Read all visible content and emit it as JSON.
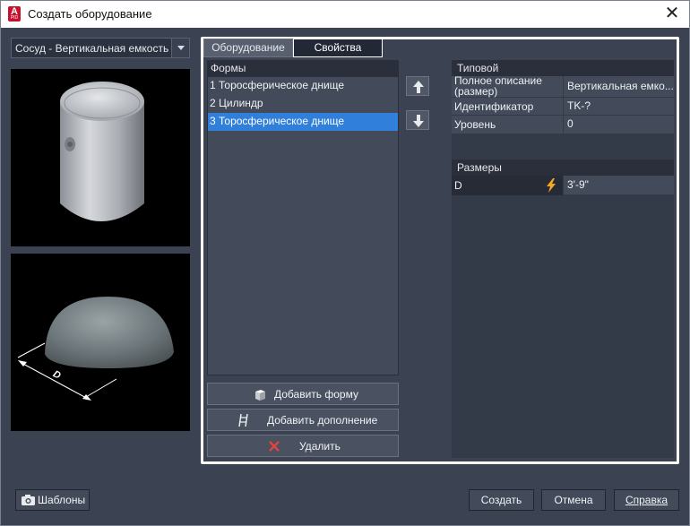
{
  "window": {
    "title": "Создать оборудование",
    "app_icon_letter": "A",
    "app_icon_sub": "PID"
  },
  "type_selector": {
    "value": "Сосуд - Вертикальная емкость"
  },
  "tabs": [
    {
      "label": "Оборудование",
      "active": false
    },
    {
      "label": "Свойства",
      "active": true
    }
  ],
  "shapes": {
    "header": "Формы",
    "items": [
      {
        "label": "1 Торосферическое днище",
        "selected": false
      },
      {
        "label": "2 Цилиндр",
        "selected": false
      },
      {
        "label": "3 Торосферическое днище",
        "selected": true
      }
    ]
  },
  "actions": {
    "add_shape": "Добавить форму",
    "add_addon": "Добавить дополнение",
    "delete": "Удалить"
  },
  "properties": {
    "typical_header": "Типовой",
    "rows": [
      {
        "name": "Полное описание (размер)",
        "value": "Вертикальная емко..."
      },
      {
        "name": "Идентификатор",
        "value": "TK-?"
      },
      {
        "name": "Уровень",
        "value": "0"
      }
    ],
    "sizes_header": "Размеры",
    "size_rows": [
      {
        "name": "D",
        "value": "3'-9\""
      }
    ]
  },
  "preview": {
    "dimension_label": "D"
  },
  "buttons": {
    "templates": "Шаблоны",
    "create": "Создать",
    "cancel": "Отмена",
    "help": "Справка"
  },
  "colors": {
    "background": "#3b4352",
    "selection": "#2f7fdb",
    "panel_border": "#ffffff",
    "bolt": "#f5a623",
    "delete_icon": "#e0443c"
  }
}
